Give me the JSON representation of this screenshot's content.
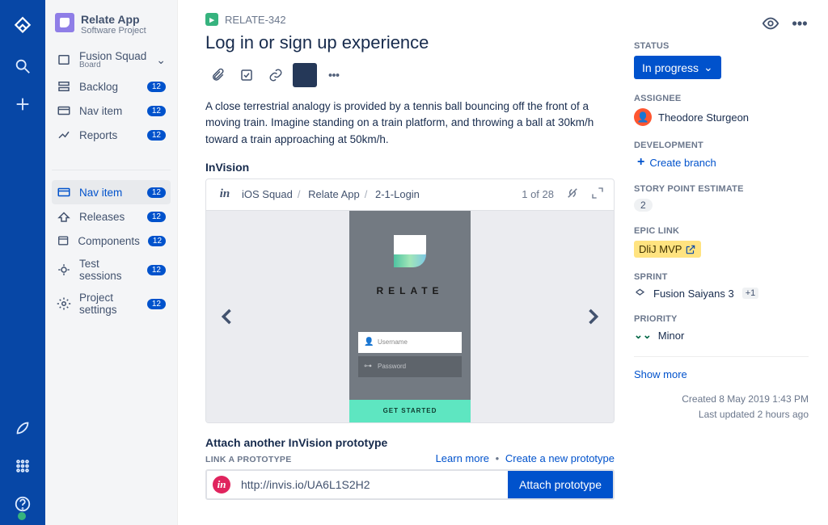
{
  "project": {
    "name": "Relate App",
    "subtitle": "Software Project"
  },
  "sidebar": {
    "group1": [
      {
        "label": "Fusion Squad",
        "sub": "Board",
        "chevron": true
      },
      {
        "label": "Backlog",
        "badge": "12"
      },
      {
        "label": "Nav item",
        "badge": "12"
      },
      {
        "label": "Reports",
        "badge": "12"
      }
    ],
    "group2": [
      {
        "label": "Nav item",
        "badge": "12",
        "active": true
      },
      {
        "label": "Releases",
        "badge": "12"
      },
      {
        "label": "Components",
        "badge": "12"
      },
      {
        "label": "Test sessions",
        "badge": "12"
      },
      {
        "label": "Project settings",
        "badge": "12"
      }
    ]
  },
  "issue": {
    "key": "RELATE-342",
    "title": "Log in or sign up experience",
    "description": "A close terrestrial analogy is provided by a tennis ball bouncing off the front of a moving train. Imagine standing on a train platform, and throwing a ball at 30km/h toward a train approaching at 50km/h."
  },
  "invision": {
    "section": "InVision",
    "breadcrumbs": [
      "iOS Squad",
      "Relate App",
      "2-1-Login"
    ],
    "counter": "1 of 28",
    "mock": {
      "brand": "RELATE",
      "username": "Username",
      "password": "Password",
      "cta": "GET STARTED"
    }
  },
  "attach": {
    "title": "Attach another InVision prototype",
    "link_label": "LINK A PROTOTYPE",
    "learn_more": "Learn more",
    "create_new": "Create a new prototype",
    "url": "http://invis.io/UA6L1S2H2",
    "button": "Attach prototype"
  },
  "panel": {
    "status_label": "STATUS",
    "status_value": "In progress",
    "assignee_label": "ASSIGNEE",
    "assignee_value": "Theodore Sturgeon",
    "development_label": "DEVELOPMENT",
    "create_branch": "Create branch",
    "sp_label": "STORY POINT ESTIMATE",
    "sp_value": "2",
    "epic_label": "EPIC LINK",
    "epic_value": "DliJ MVP",
    "sprint_label": "SPRINT",
    "sprint_value": "Fusion Saiyans 3",
    "sprint_extra": "+1",
    "priority_label": "PRIORITY",
    "priority_value": "Minor",
    "show_more": "Show more",
    "created": "Created 8 May 2019 1:43 PM",
    "updated": "Last updated 2 hours ago"
  }
}
